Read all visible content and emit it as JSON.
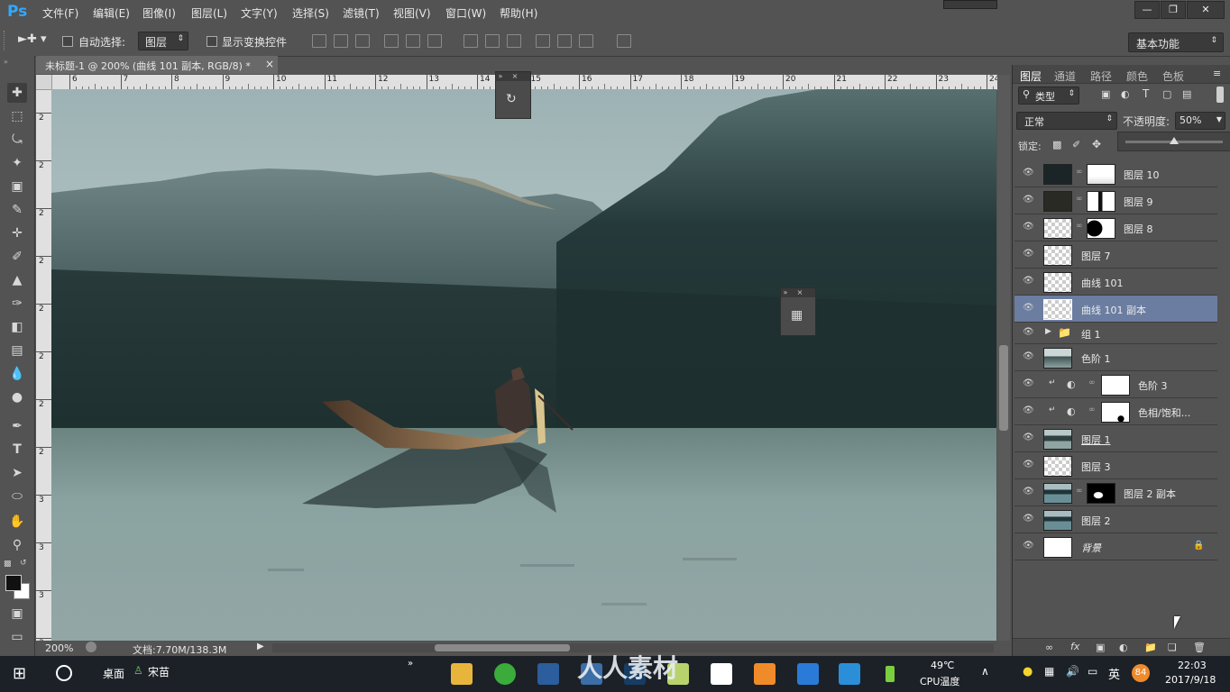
{
  "app": {
    "logo": "Ps"
  },
  "menu": [
    "文件(F)",
    "编辑(E)",
    "图像(I)",
    "图层(L)",
    "文字(Y)",
    "选择(S)",
    "滤镜(T)",
    "视图(V)",
    "窗口(W)",
    "帮助(H)"
  ],
  "options": {
    "auto_select_label": "自动选择:",
    "auto_select_target": "图层",
    "transform_controls_label": "显示变换控件",
    "workspace": "基本功能"
  },
  "document": {
    "tab_title": "未标题-1 @ 200% (曲线 101 副本, RGB/8) *",
    "close_glyph": "×",
    "ruler_h": [
      "6",
      "7",
      "8",
      "9",
      "10",
      "11",
      "12",
      "13",
      "14",
      "15",
      "16",
      "17",
      "18",
      "19",
      "20",
      "21",
      "22",
      "23",
      "24"
    ],
    "ruler_v": [
      "2",
      "2",
      "2",
      "2",
      "2",
      "2",
      "2",
      "2",
      "3",
      "3",
      "3",
      "3"
    ],
    "zoom": "200%",
    "doc_size": "文档:7.70M/138.3M"
  },
  "layers_panel": {
    "tabs": [
      "图层",
      "通道",
      "路径",
      "颜色",
      "色板"
    ],
    "filter_kind": "类型",
    "blend_mode": "正常",
    "opacity_label": "不透明度:",
    "opacity_value": "50%",
    "lock_label": "锁定:",
    "layers": [
      {
        "name": "图层 10"
      },
      {
        "name": "图层 9"
      },
      {
        "name": "图层 8"
      },
      {
        "name": "图层 7"
      },
      {
        "name": "曲线 101"
      },
      {
        "name": "曲线 101 副本"
      },
      {
        "name": "组 1"
      },
      {
        "name": "色阶 1"
      },
      {
        "name": "色阶 3"
      },
      {
        "name": "色相/饱和..."
      },
      {
        "name": "图层 1"
      },
      {
        "name": "图层 3"
      },
      {
        "name": "图层 2 副本"
      },
      {
        "name": "图层 2"
      },
      {
        "name": "背景"
      }
    ]
  },
  "taskbar": {
    "desktop_label": "桌面",
    "user_label": "宋苗",
    "watermark": "人人素材",
    "cpu_temp": "49℃",
    "cpu_label": "CPU温度",
    "ime": "英",
    "badge": "84",
    "time": "22:03",
    "date": "2017/9/18"
  }
}
